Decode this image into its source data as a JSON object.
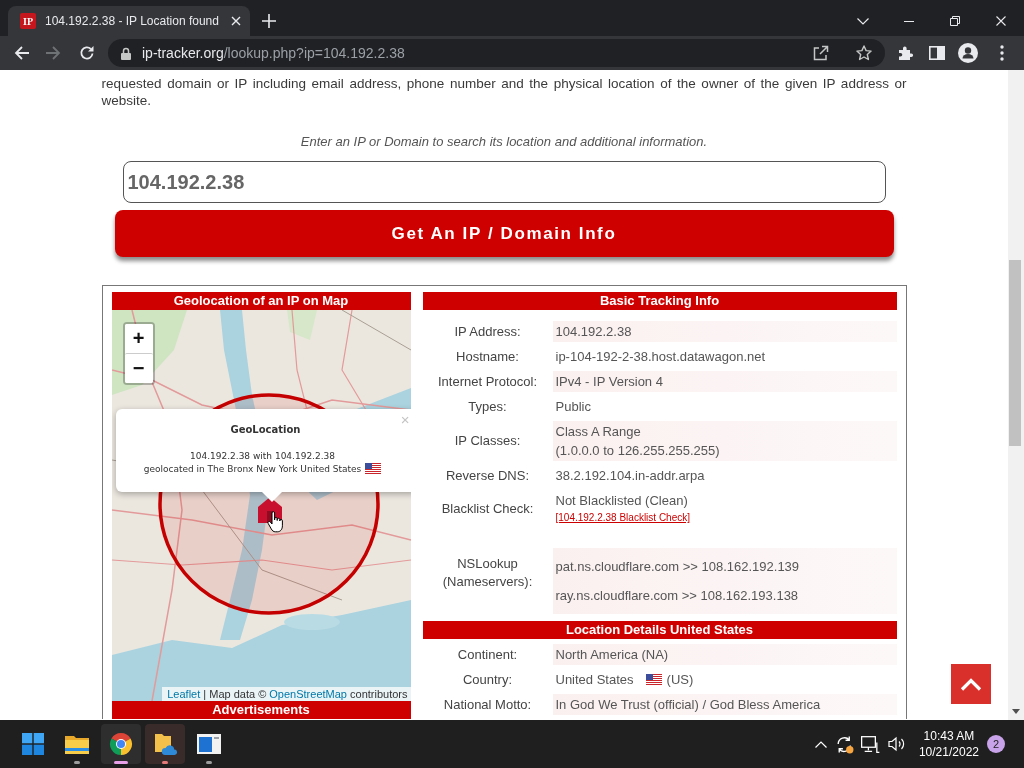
{
  "browser": {
    "tabs": [
      {
        "favicon_text": "IP",
        "title": "104.192.2.38 - IP Location found",
        "selected": true
      }
    ],
    "address": {
      "host": "ip-tracker.org",
      "path": "/lookup.php?ip=104.192.2.38"
    }
  },
  "intro": "requested domain or IP including email address, phone number and the physical location of the owner of the given IP address or website.",
  "search": {
    "hint": "Enter an IP or Domain to search its location and additional information.",
    "value": "104.192.2.38",
    "button": "Get An IP / Domain Info"
  },
  "map_panel": {
    "title": "Geolocation of an IP on Map",
    "zoom_in": "+",
    "zoom_out": "−",
    "popup": {
      "title": "GeoLocation",
      "close": "×",
      "lines": [
        "104.192.2.38 with 104.192.2.38",
        "geolocated in The Bronx New York United States"
      ]
    },
    "attribution": [
      {
        "text": "Leaflet",
        "link": true
      },
      {
        "text": " | Map data © ",
        "link": false
      },
      {
        "text": "OpenStreetMap",
        "link": true
      },
      {
        "text": " contributors",
        "link": false
      }
    ],
    "footer_title": "Advertisements"
  },
  "sections": [
    {
      "title": "Basic Tracking Info",
      "rows": [
        {
          "kind": "text",
          "label": "IP Address:",
          "value": "104.192.2.38",
          "highlighted": true
        },
        {
          "kind": "text",
          "label": "Hostname:",
          "value": "ip-104-192-2-38.host.datawagon.net",
          "highlighted": false
        },
        {
          "kind": "text",
          "label": "Internet Protocol:",
          "value": "IPv4 - IP Version 4",
          "highlighted": true
        },
        {
          "kind": "text",
          "label": "Types:",
          "value": "Public",
          "highlighted": false
        },
        {
          "kind": "lines",
          "label": "IP Classes:",
          "lines": [
            "Class A Range",
            "(1.0.0.0 to 126.255.255.255)"
          ],
          "highlighted": true
        },
        {
          "kind": "text",
          "label": "Reverse DNS:",
          "value": "38.2.192.104.in-addr.arpa",
          "highlighted": false
        },
        {
          "kind": "link",
          "label": "Blacklist Check:",
          "value": "Not Blacklisted (Clean)",
          "link": "[104.192.2.38 Blacklist Check]",
          "highlighted": false
        },
        {
          "kind": "list",
          "label": "NSLookup (Nameservers):",
          "items": [
            "pat.ns.cloudflare.com >> 108.162.192.139",
            "ray.ns.cloudflare.com >> 108.162.193.138"
          ],
          "highlighted": true
        }
      ]
    },
    {
      "title": "Location Details United States",
      "rows": [
        {
          "kind": "text",
          "label": "Continent:",
          "value": "North America (NA)",
          "highlighted": true
        },
        {
          "kind": "flag",
          "label": "Country:",
          "value": "United States",
          "suffix": "(US)",
          "highlighted": false
        },
        {
          "kind": "text",
          "label": "National Motto:",
          "value": "In God We Trust (official) / God Bless America",
          "highlighted": true
        }
      ]
    }
  ],
  "taskbar": {
    "apps": [
      {
        "kind": "start",
        "running": false,
        "active": false,
        "attention": false
      },
      {
        "kind": "folder",
        "running": true,
        "active": false,
        "attention": false
      },
      {
        "kind": "browser",
        "running": true,
        "active": true,
        "attention": false
      },
      {
        "kind": "cloud-folder",
        "running": true,
        "active": false,
        "attention": true
      },
      {
        "kind": "window",
        "running": true,
        "active": false,
        "attention": false
      }
    ],
    "time": "10:43 AM",
    "date": "10/21/2022",
    "notifications": "2"
  }
}
